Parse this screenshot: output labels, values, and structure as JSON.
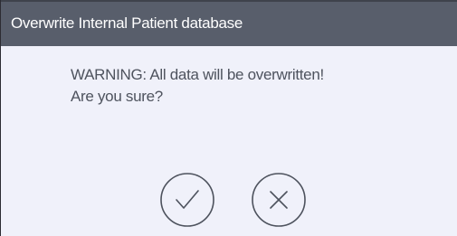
{
  "dialog": {
    "title": "Overwrite Internal Patient database",
    "message_line1": "WARNING: All data will be overwritten!",
    "message_line2": "Are you sure?",
    "confirm_icon": "checkmark-icon",
    "cancel_icon": "x-icon"
  },
  "colors": {
    "titlebar": "#585e6b",
    "background": "#f0f1fa",
    "text": "#4e535e",
    "icon_stroke": "#4d525d"
  }
}
